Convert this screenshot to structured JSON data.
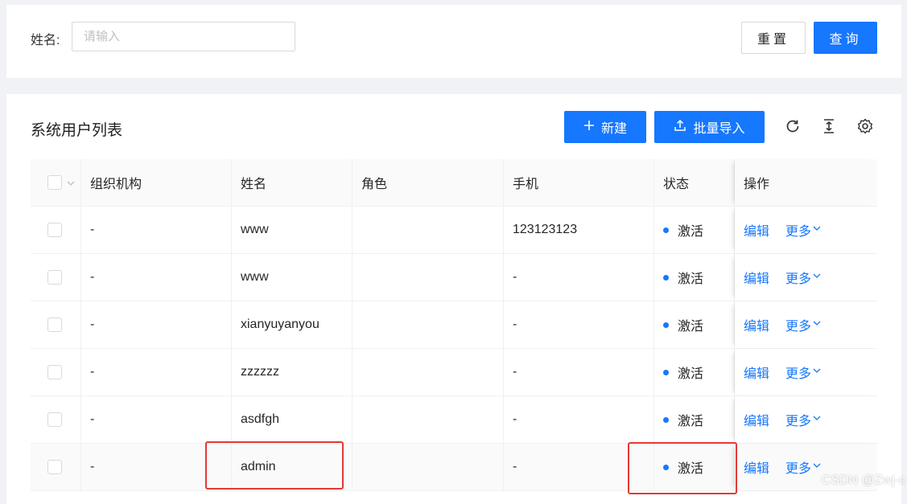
{
  "search": {
    "label": "姓名:",
    "placeholder": "请输入",
    "reset_label": "重置",
    "query_label": "查询"
  },
  "list": {
    "title": "系统用户列表",
    "new_label": "新建",
    "import_label": "批量导入",
    "tools": [
      "reload-icon",
      "column-height-icon",
      "setting-icon"
    ]
  },
  "table": {
    "columns": [
      "组织机构",
      "姓名",
      "角色",
      "手机",
      "状态",
      "操作"
    ],
    "rows": [
      {
        "org": "-",
        "name": "www",
        "role": "",
        "phone": "123123123",
        "status": "激活"
      },
      {
        "org": "-",
        "name": "www",
        "role": "",
        "phone": "-",
        "status": "激活"
      },
      {
        "org": "-",
        "name": "xianyuyanyou",
        "role": "",
        "phone": "-",
        "status": "激活"
      },
      {
        "org": "-",
        "name": "zzzzzz",
        "role": "",
        "phone": "-",
        "status": "激活"
      },
      {
        "org": "-",
        "name": "asdfgh",
        "role": "",
        "phone": "-",
        "status": "激活"
      },
      {
        "org": "-",
        "name": "admin",
        "role": "",
        "phone": "-",
        "status": "激活"
      }
    ],
    "edit_label": "编辑",
    "more_label": "更多"
  },
  "colors": {
    "primary": "#1677ff",
    "highlight": "#e53935"
  },
  "watermark": "CSDN @Zwj-c"
}
